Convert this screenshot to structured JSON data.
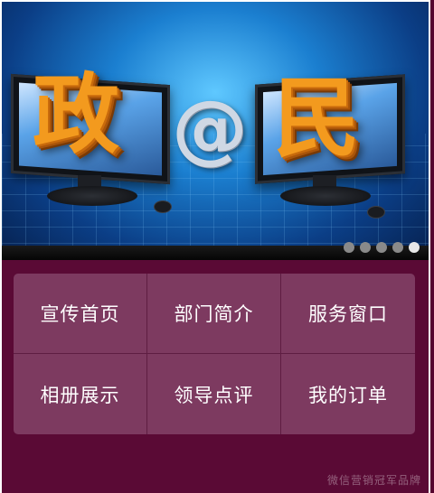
{
  "banner": {
    "left_char": "政",
    "at_sign": "@",
    "right_char": "民",
    "slides": [
      {
        "active": false
      },
      {
        "active": false
      },
      {
        "active": false
      },
      {
        "active": false
      },
      {
        "active": true
      }
    ]
  },
  "menu": {
    "items": [
      {
        "label": "宣传首页"
      },
      {
        "label": "部门简介"
      },
      {
        "label": "服务窗口"
      },
      {
        "label": "相册展示"
      },
      {
        "label": "领导点评"
      },
      {
        "label": "我的订单"
      }
    ]
  },
  "watermark": "微信营销冠军品牌",
  "colors": {
    "background": "#5a0a35",
    "menu_panel": "#7d3a60",
    "accent_orange": "#f39a1e"
  }
}
